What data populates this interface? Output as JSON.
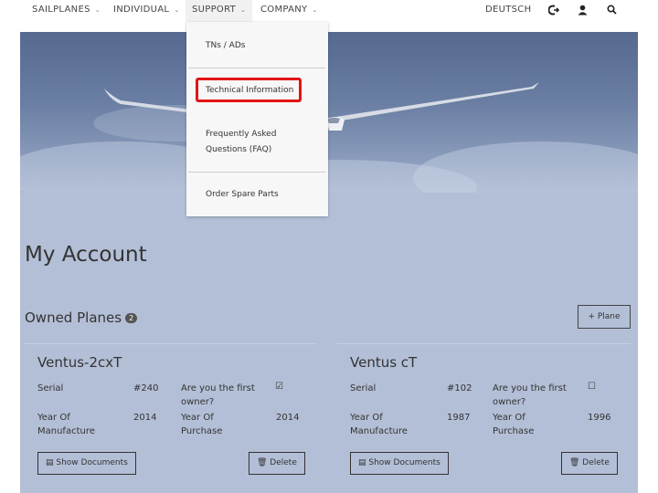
{
  "nav": {
    "sailplanes": "SAILPLANES",
    "individual": "INDIVIDUAL",
    "support": "SUPPORT",
    "company": "COMPANY",
    "language": "DEUTSCH"
  },
  "dropdown": {
    "items": [
      "TNs / ADs",
      "Technical Information",
      "Frequently Asked",
      "Questions (FAQ)",
      "Order Spare Parts"
    ]
  },
  "page": {
    "title": "My Account",
    "section_title": "Owned Planes",
    "owned_count": "2",
    "add_plane": "+ Plane"
  },
  "planes": [
    {
      "name": "Ventus-2cxT",
      "serial_label": "Serial",
      "serial": "#240",
      "first_owner_label_1": "Are you the first",
      "first_owner_label_2": "owner?",
      "first_owner_mark": "☑",
      "year_mfg_label_1": "Year Of",
      "year_mfg_label_2": "Manufacture",
      "year_mfg": "2014",
      "year_purchase_label_1": "Year Of",
      "year_purchase_label_2": "Purchase",
      "year_purchase": "2014",
      "show_documents": "Show Documents",
      "delete": "Delete"
    },
    {
      "name": "Ventus cT",
      "serial_label": "Serial",
      "serial": "#102",
      "first_owner_label_1": "Are you the first",
      "first_owner_label_2": "owner?",
      "first_owner_mark": "☐",
      "year_mfg_label_1": "Year Of",
      "year_mfg_label_2": "Manufacture",
      "year_mfg": "1987",
      "year_purchase_label_1": "Year Of",
      "year_purchase_label_2": "Purchase",
      "year_purchase": "1996",
      "show_documents": "Show Documents",
      "delete": "Delete"
    }
  ]
}
